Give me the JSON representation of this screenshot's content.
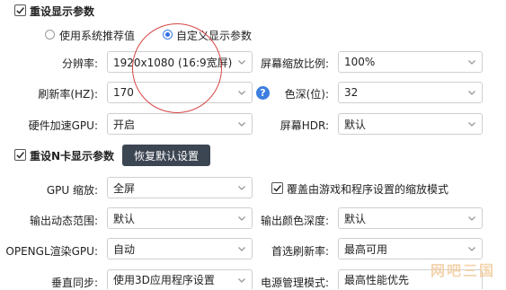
{
  "reset_display": {
    "checked": true,
    "label": "重设显示参数"
  },
  "mode": {
    "system": "使用系统推荐值",
    "custom": "自定义显示参数",
    "selected": "custom"
  },
  "fields": {
    "resolution": {
      "label": "分辨率:",
      "value": "1920x1080 (16:9宽屏)"
    },
    "scale": {
      "label": "屏幕缩放比例:",
      "value": "100%"
    },
    "refresh": {
      "label": "刷新率(HZ):",
      "value": "170"
    },
    "color_depth": {
      "label": "色深(位):",
      "value": "32"
    },
    "hw_accel": {
      "label": "硬件加速GPU:",
      "value": "开启"
    },
    "hdr": {
      "label": "屏幕HDR:",
      "value": "默认"
    }
  },
  "reset_nvidia": {
    "checked": true,
    "label": "重设N卡显示参数",
    "restore_button": "恢复默认设置"
  },
  "nvidia": {
    "gpu_scale": {
      "label": "GPU 缩放:",
      "value": "全屏"
    },
    "override": {
      "checked": true,
      "label": "覆盖由游戏和程序设置的缩放模式"
    },
    "dynamic_range": {
      "label": "输出动态范围:",
      "value": "默认"
    },
    "color_format": {
      "label": "输出颜色深度:",
      "value": "默认"
    },
    "opengl": {
      "label": "OPENGL渲染GPU:",
      "value": "自动"
    },
    "preferred_refresh": {
      "label": "首选刷新率:",
      "value": "最高可用"
    },
    "vsync": {
      "label": "垂直同步:",
      "value": "使用3D应用程序设置"
    },
    "power": {
      "label": "电源管理模式:",
      "value": "最高性能优先"
    }
  },
  "watermark": "网吧三国",
  "colors": {
    "accent": "#2f6fe4",
    "button_bg": "#3c4552",
    "annotation": "#d64545"
  }
}
